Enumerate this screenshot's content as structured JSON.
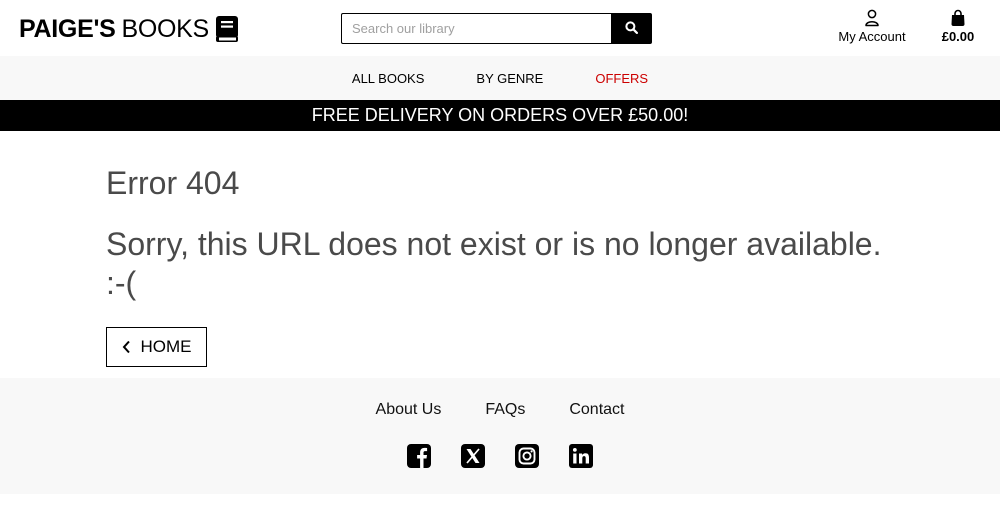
{
  "brand": {
    "name_strong": "PAIGE'S",
    "name_light": "BOOKS",
    "icon": "book-icon"
  },
  "search": {
    "placeholder": "Search our library",
    "value": "",
    "button_icon": "search-icon"
  },
  "account": {
    "label": "My Account",
    "icon": "user-icon"
  },
  "basket": {
    "total": "£0.00",
    "icon": "shopping-bag-icon"
  },
  "nav": {
    "items": [
      {
        "label": "ALL BOOKS"
      },
      {
        "label": "BY GENRE"
      },
      {
        "label": "OFFERS",
        "color": "#cc0000"
      }
    ]
  },
  "banner": {
    "text": "FREE DELIVERY ON ORDERS OVER £50.00!"
  },
  "main": {
    "title": "Error 404",
    "message": "Sorry, this URL does not exist or is no longer available. :-(",
    "home_button": {
      "label": "HOME",
      "icon": "chevron-left-icon"
    }
  },
  "footer": {
    "links": [
      {
        "label": "About Us"
      },
      {
        "label": "FAQs"
      },
      {
        "label": "Contact"
      }
    ],
    "socials": [
      {
        "icon": "facebook-icon"
      },
      {
        "icon": "x-twitter-icon"
      },
      {
        "icon": "instagram-icon"
      },
      {
        "icon": "linkedin-icon"
      }
    ]
  },
  "colors": {
    "accent_offer": "#cc0000",
    "banner_bg": "#000000",
    "nav_bg": "#f8f8f8",
    "heading_text": "#4a4a4a"
  }
}
